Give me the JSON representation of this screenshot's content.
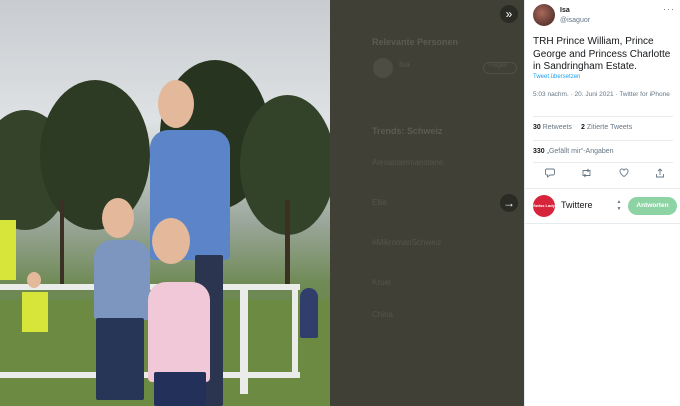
{
  "viewer": {
    "collapse_icon": "»",
    "next_icon": "→",
    "background_panel": {
      "heading_people": "Relevante Personen",
      "person_name": "Isa",
      "follow_label": "Folgen",
      "heading_trends": "Trends: Schweiz",
      "trends": [
        "Alexandermaristane",
        "Ellie",
        "#MikromanSchweiz",
        "Kruel",
        "China"
      ]
    }
  },
  "tweet": {
    "author_name": "Isa",
    "author_handle": "@isaguor",
    "more_icon": "···",
    "text": "TRH Prince William, Prince George and Princess Charlotte in Sandringham Estate.",
    "translate_label": "Tweet übersetzen",
    "timestamp": "5:03 nachm. · 20. Juni 2021 · Twitter for iPhone",
    "retweets_count": "30",
    "retweets_label": "Retweets",
    "quotes_count": "2",
    "quotes_label": "Zitierte Tweets",
    "likes_count": "330",
    "likes_label": "„Gefällt mir“-Angaben"
  },
  "actions": {
    "reply_icon": "speech-bubble-icon",
    "retweet_icon": "retweet-icon",
    "like_icon": "heart-icon",
    "share_icon": "share-icon"
  },
  "reply": {
    "logo_text": "Swiss Lady",
    "placeholder": "Twittere",
    "button_label": "Antworten"
  },
  "colors": {
    "accent": "#1da1f2",
    "reply_button": "#8ed3a4",
    "logo": "#d6243a"
  }
}
